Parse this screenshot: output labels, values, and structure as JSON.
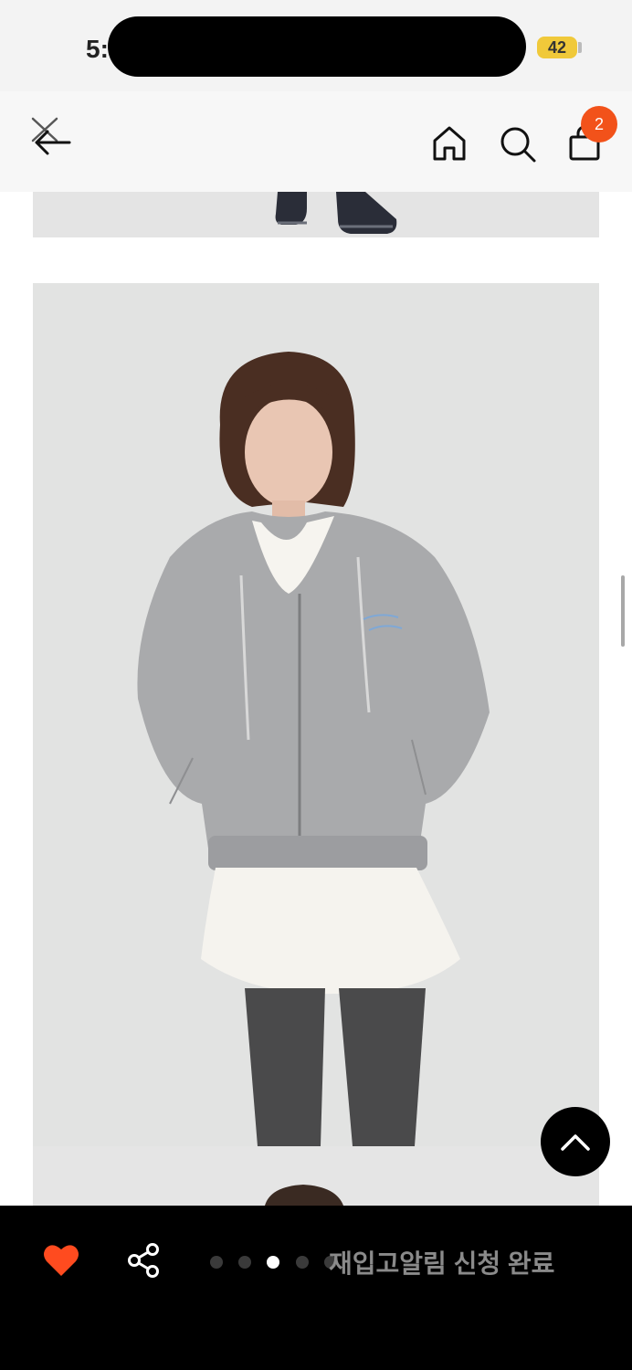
{
  "status_bar": {
    "time": "5:",
    "battery": "42"
  },
  "header": {
    "cart_badge": "2"
  },
  "gallery": {
    "pages": 5,
    "active_page": 3
  },
  "bottom_bar": {
    "restock_label": "재입고알림 신청 완료"
  },
  "colors": {
    "accent": "#f2521a",
    "heart": "#ff4b1f",
    "bar": "#000000"
  }
}
